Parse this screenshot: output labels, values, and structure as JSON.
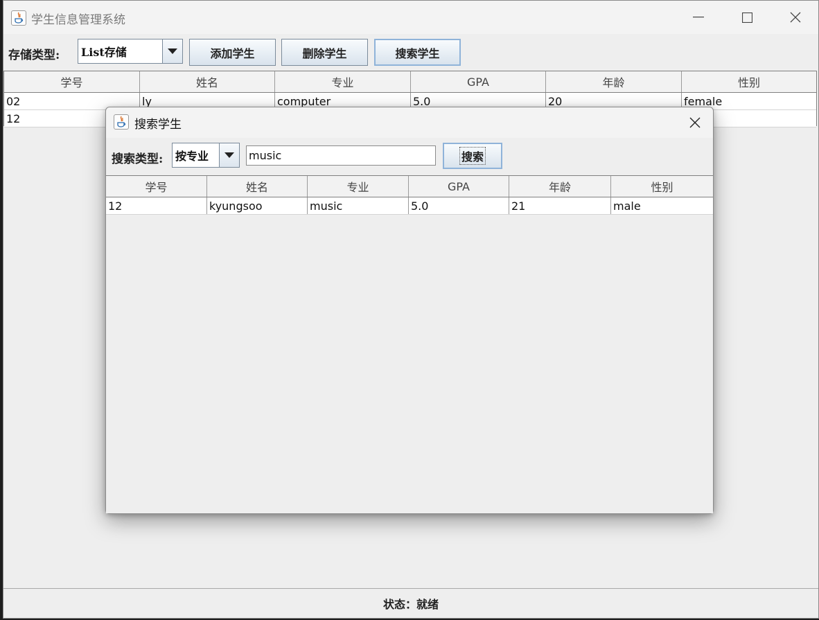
{
  "main": {
    "title": "学生信息管理系统",
    "toolbar": {
      "storage_label": "存储类型:",
      "storage_value": "List存储",
      "add_button": "添加学生",
      "delete_button": "删除学生",
      "search_button": "搜索学生"
    },
    "table": {
      "headers": [
        "学号",
        "姓名",
        "专业",
        "GPA",
        "年龄",
        "性别"
      ],
      "rows": [
        [
          "02",
          "ly",
          "computer",
          "5.0",
          "20",
          "female"
        ],
        [
          "12",
          "",
          "",
          "",
          "",
          ""
        ]
      ]
    },
    "status": "状态：就绪"
  },
  "dialog": {
    "title": "搜索学生",
    "search_type_label": "搜索类型:",
    "search_type_value": "按专业",
    "search_text": "music",
    "search_button": "搜索",
    "table": {
      "headers": [
        "学号",
        "姓名",
        "专业",
        "GPA",
        "年龄",
        "性别"
      ],
      "rows": [
        [
          "12",
          "kyungsoo",
          "music",
          "5.0",
          "21",
          "male"
        ]
      ]
    }
  },
  "colors": {
    "window_bg": "#eeeeee",
    "button_border_focus": "#8fb3d9",
    "java_icon": "#d9722b"
  },
  "icons": [
    "java-app-icon",
    "minimize-icon",
    "maximize-icon",
    "close-icon",
    "dropdown-arrow-icon"
  ]
}
